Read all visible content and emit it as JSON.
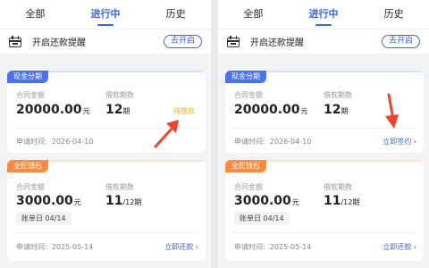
{
  "tabs": [
    "全部",
    "进行中",
    "历史"
  ],
  "active_tab": "进行中",
  "reminder": {
    "text": "开启还款提醒",
    "button": "去开启"
  },
  "labels": {
    "contract_amount": "合同金额",
    "loan_periods": "借款期数",
    "apply_time": "申请时间:"
  },
  "left": {
    "card1": {
      "tag": "现金分期",
      "amount": "20000.00",
      "amount_unit": "元",
      "periods": "12",
      "periods_unit": "期",
      "apply_date": "2026-04-10",
      "status": "待放款"
    },
    "card2": {
      "tag": "全民钱包",
      "amount": "3000.00",
      "amount_unit": "元",
      "periods": "11",
      "periods_unit": "/12期",
      "bill_day": "账单日 04/14",
      "apply_date": "2025-05-14",
      "action": "立即还款 ›"
    }
  },
  "right": {
    "card1": {
      "tag": "现金分期",
      "amount": "20000.00",
      "amount_unit": "元",
      "periods": "12",
      "periods_unit": "期",
      "apply_date": "2026-04-10",
      "action": "立即签约 ›"
    },
    "card2": {
      "tag": "全民钱包",
      "amount": "3000.00",
      "amount_unit": "元",
      "periods": "11",
      "periods_unit": "/12期",
      "bill_day": "账单日 04/14",
      "apply_date": "2025-05-14",
      "action": "立即还款 ›"
    }
  },
  "colors": {
    "accent": "#3a63e8",
    "pending": "#f5b400",
    "tag_blue": "#4a72f0",
    "tag_orange": "#ff8a3d",
    "arrow": "#f0442e"
  }
}
